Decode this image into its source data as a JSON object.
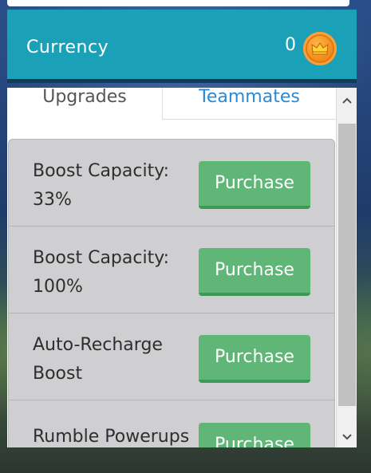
{
  "header": {
    "currency_label": "Currency",
    "currency_amount": "0",
    "coin_icon": "crown-coin-icon"
  },
  "tabs": [
    {
      "label": "Upgrades",
      "active": true
    },
    {
      "label": "Teammates",
      "active": false
    }
  ],
  "upgrades": [
    {
      "title_line1": "Boost Capacity:",
      "title_line2": "33%",
      "button": "Purchase"
    },
    {
      "title_line1": "Boost Capacity:",
      "title_line2": "100%",
      "button": "Purchase"
    },
    {
      "title_line1": "Auto-Recharge",
      "title_line2": "Boost",
      "button": "Purchase"
    },
    {
      "title_line1": "Rumble Powerups",
      "title_line2": "",
      "button": "Purchase"
    }
  ],
  "colors": {
    "header_bg": "#1aa1b8",
    "button_green": "#5fb677",
    "link_blue": "#2a8ad6"
  }
}
